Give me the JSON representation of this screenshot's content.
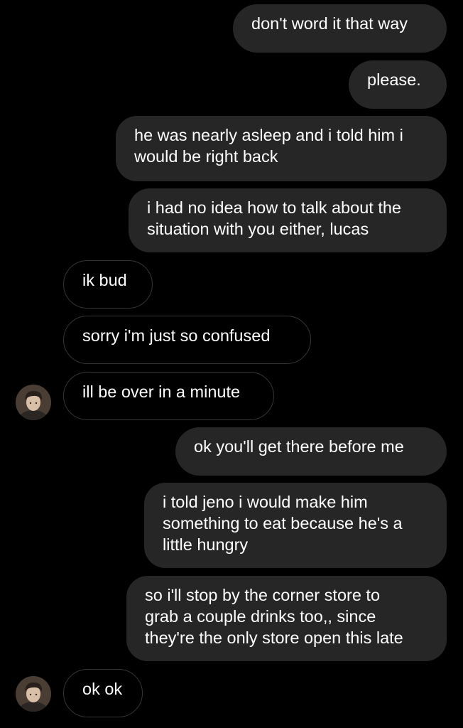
{
  "thread": {
    "messages": [
      {
        "side": "sent",
        "lines": [
          "don't word it that way"
        ]
      },
      {
        "side": "sent",
        "lines": [
          "please."
        ]
      },
      {
        "side": "sent",
        "lines": [
          "he was nearly asleep and i told him i",
          "would be right back"
        ]
      },
      {
        "side": "sent",
        "lines": [
          "i had no idea how to talk about the",
          "situation with you either, lucas"
        ]
      },
      {
        "side": "received",
        "lines": [
          "ik bud"
        ]
      },
      {
        "side": "received",
        "lines": [
          "sorry i'm just so confused"
        ]
      },
      {
        "side": "received",
        "lines": [
          "ill be over in a minute"
        ],
        "avatar": "profile-avatar"
      },
      {
        "side": "sent",
        "lines": [
          "ok you'll get there before me"
        ]
      },
      {
        "side": "sent",
        "lines": [
          "i told jeno i would make him",
          "something to eat because he's a",
          "little hungry"
        ]
      },
      {
        "side": "sent",
        "lines": [
          "so i'll stop by the corner store to",
          "grab a couple drinks too,, since",
          "they're the only store open this late"
        ]
      },
      {
        "side": "received",
        "lines": [
          "ok ok"
        ],
        "avatar": "profile-avatar"
      }
    ]
  },
  "colors": {
    "background": "#000000",
    "sent_bubble": "#262626",
    "received_border": "#363636",
    "text": "#ffffff"
  }
}
